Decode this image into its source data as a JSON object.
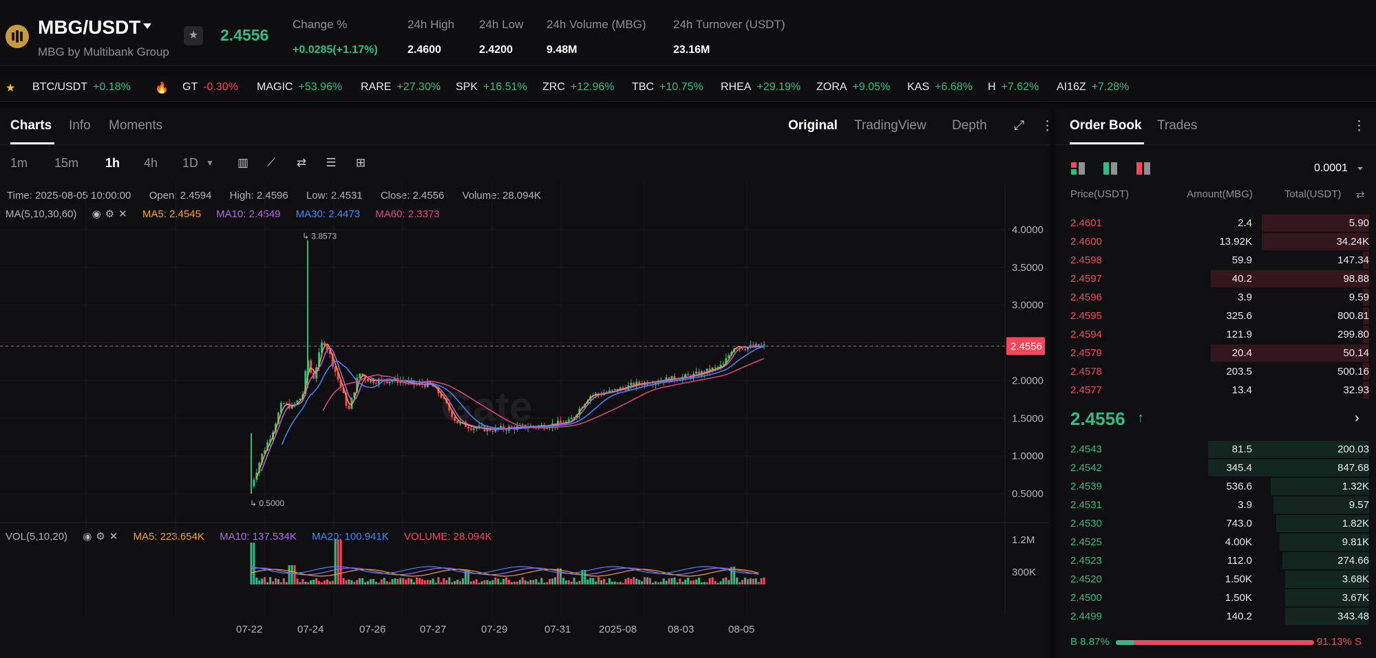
{
  "header": {
    "pair": "MBG/USDT",
    "subtitle": "MBG by Multibank Group",
    "last_price": "2.4556",
    "stats": [
      {
        "label": "Change %",
        "value": "+0.0285(+1.17%)",
        "up": true
      },
      {
        "label": "24h High",
        "value": "2.4600"
      },
      {
        "label": "24h Low",
        "value": "2.4200"
      },
      {
        "label": "24h Volume (MBG)",
        "value": "9.48M"
      },
      {
        "label": "24h Turnover (USDT)",
        "value": "23.16M"
      }
    ]
  },
  "ticker": [
    {
      "sym": "BTC/USDT",
      "chg": "+0.18%",
      "dir": "up"
    },
    {
      "sym": "GT",
      "chg": "-0.30%",
      "dir": "dn"
    },
    {
      "sym": "MAGIC",
      "chg": "+53.96%",
      "dir": "up"
    },
    {
      "sym": "RARE",
      "chg": "+27.30%",
      "dir": "up"
    },
    {
      "sym": "SPK",
      "chg": "+16.51%",
      "dir": "up"
    },
    {
      "sym": "ZRC",
      "chg": "+12.96%",
      "dir": "up"
    },
    {
      "sym": "TBC",
      "chg": "+10.75%",
      "dir": "up"
    },
    {
      "sym": "RHEA",
      "chg": "+29.19%",
      "dir": "up"
    },
    {
      "sym": "ZORA",
      "chg": "+9.05%",
      "dir": "up"
    },
    {
      "sym": "KAS",
      "chg": "+6.68%",
      "dir": "up"
    },
    {
      "sym": "H",
      "chg": "+7.62%",
      "dir": "up"
    },
    {
      "sym": "AI16Z",
      "chg": "+7.28%",
      "dir": "up"
    }
  ],
  "chart_tabs": [
    "Charts",
    "Info",
    "Moments"
  ],
  "view_tabs": [
    "Original",
    "TradingView",
    "Depth"
  ],
  "intervals": [
    "1m",
    "15m",
    "1h",
    "4h",
    "1D"
  ],
  "selected_interval": "1h",
  "candle_info": {
    "time": "Time: 2025-08-05 10:00:00",
    "open": "Open: 2.4594",
    "high": "High: 2.4596",
    "low": "Low: 2.4531",
    "close": "Close: 2.4556",
    "volume": "Volume: 28.094K"
  },
  "ma_legend": {
    "title": "MA(5,10,30,60)",
    "ma5": "MA5: 2.4545",
    "ma10": "MA10: 2.4549",
    "ma30": "MA30: 2.4473",
    "ma60": "MA60: 2.3373"
  },
  "vol_legend": {
    "title": "VOL(5,10,20)",
    "ma5": "MA5: 223.654K",
    "ma10": "MA10: 137.534K",
    "ma20": "MA20: 100.941K",
    "volume": "VOLUME: 28.094K"
  },
  "colors": {
    "up": "#2ebd85",
    "down": "#f6465d",
    "ma5": "#f7a21b",
    "ma10": "#b067e6",
    "ma30": "#3d8bfd",
    "ma60": "#e0457b"
  },
  "chart_data": {
    "type": "line",
    "price_axis_ticks": [
      "4.0000",
      "3.5000",
      "3.0000",
      "2.5000",
      "2.0000",
      "1.5000",
      "1.0000",
      "0.5000"
    ],
    "price_range": [
      0.3,
      4.4
    ],
    "volume_axis_ticks": [
      "1.2M",
      "300K"
    ],
    "x_ticks": [
      "07-22",
      "07-24",
      "07-26",
      "07-27",
      "07-29",
      "07-31",
      "2025-08",
      "08-03",
      "08-05"
    ],
    "current_price": "2.4556",
    "high_marker": "3.8573",
    "low_marker": "0.5000",
    "approx_close_path": [
      [
        0,
        0.6
      ],
      [
        2,
        1.0
      ],
      [
        4,
        1.3
      ],
      [
        6,
        1.7
      ],
      [
        8,
        1.65
      ],
      [
        10,
        1.8
      ],
      [
        11,
        2.3
      ],
      [
        12,
        2.0
      ],
      [
        14,
        2.55
      ],
      [
        15,
        2.4
      ],
      [
        17,
        2.0
      ],
      [
        19,
        1.6
      ],
      [
        21,
        2.1
      ],
      [
        23,
        2.0
      ],
      [
        26,
        2.0
      ],
      [
        29,
        2.0
      ],
      [
        32,
        1.95
      ],
      [
        35,
        1.95
      ],
      [
        37,
        1.8
      ],
      [
        40,
        1.45
      ],
      [
        43,
        1.38
      ],
      [
        47,
        1.35
      ],
      [
        52,
        1.38
      ],
      [
        57,
        1.4
      ],
      [
        62,
        1.45
      ],
      [
        66,
        1.8
      ],
      [
        70,
        1.85
      ],
      [
        75,
        1.95
      ],
      [
        80,
        2.0
      ],
      [
        85,
        2.05
      ],
      [
        88,
        2.1
      ],
      [
        92,
        2.2
      ],
      [
        94,
        2.45
      ],
      [
        96,
        2.44
      ],
      [
        100,
        2.4556
      ]
    ],
    "volume_spikes": [
      [
        0,
        1.3
      ],
      [
        8,
        0.6
      ],
      [
        17,
        1.4
      ],
      [
        42,
        0.45
      ],
      [
        60,
        0.5
      ],
      [
        65,
        0.45
      ],
      [
        94,
        0.55
      ]
    ]
  },
  "order_book": {
    "tabs": [
      "Order Book",
      "Trades"
    ],
    "precision": "0.0001",
    "headers": {
      "price": "Price(USDT)",
      "amount": "Amount(MBG)",
      "total": "Total(USDT)"
    },
    "asks": [
      {
        "price": "2.4601",
        "amount": "2.4",
        "total": "5.90",
        "depth": 0.36
      },
      {
        "price": "2.4600",
        "amount": "13.92K",
        "total": "34.24K",
        "depth": 0.36
      },
      {
        "price": "2.4598",
        "amount": "59.9",
        "total": "147.34",
        "depth": 0.02
      },
      {
        "price": "2.4597",
        "amount": "40.2",
        "total": "98.88",
        "depth": 0.53
      },
      {
        "price": "2.4596",
        "amount": "3.9",
        "total": "9.59",
        "depth": 0.02
      },
      {
        "price": "2.4595",
        "amount": "325.6",
        "total": "800.81",
        "depth": 0.02
      },
      {
        "price": "2.4594",
        "amount": "121.9",
        "total": "299.80",
        "depth": 0.02
      },
      {
        "price": "2.4579",
        "amount": "20.4",
        "total": "50.14",
        "depth": 0.53
      },
      {
        "price": "2.4578",
        "amount": "203.5",
        "total": "500.16",
        "depth": 0.02
      },
      {
        "price": "2.4577",
        "amount": "13.4",
        "total": "32.93",
        "depth": 0.02
      }
    ],
    "mid_price": "2.4556",
    "bids": [
      {
        "price": "2.4543",
        "amount": "81.5",
        "total": "200.03",
        "depth": 0.54
      },
      {
        "price": "2.4542",
        "amount": "345.4",
        "total": "847.68",
        "depth": 0.54
      },
      {
        "price": "2.4539",
        "amount": "536.6",
        "total": "1.32K",
        "depth": 0.33
      },
      {
        "price": "2.4531",
        "amount": "3.9",
        "total": "9.57",
        "depth": 0.32
      },
      {
        "price": "2.4530",
        "amount": "743.0",
        "total": "1.82K",
        "depth": 0.31
      },
      {
        "price": "2.4525",
        "amount": "4.00K",
        "total": "9.81K",
        "depth": 0.3
      },
      {
        "price": "2.4523",
        "amount": "112.0",
        "total": "274.66",
        "depth": 0.29
      },
      {
        "price": "2.4520",
        "amount": "1.50K",
        "total": "3.68K",
        "depth": 0.28
      },
      {
        "price": "2.4500",
        "amount": "1.50K",
        "total": "3.67K",
        "depth": 0.28
      },
      {
        "price": "2.4499",
        "amount": "140.2",
        "total": "343.48",
        "depth": 0.28
      }
    ],
    "buy_ratio": "B 8.87%",
    "sell_ratio": "91.13% S",
    "buy_fraction": 0.0887
  }
}
